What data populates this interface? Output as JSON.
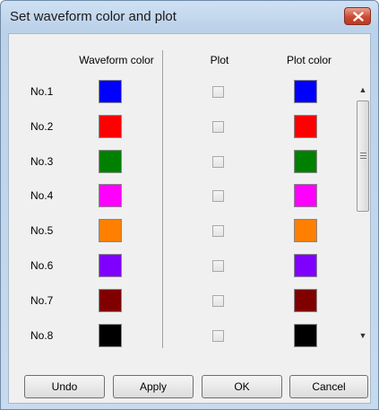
{
  "dialog": {
    "title": "Set waveform color and plot"
  },
  "headers": {
    "waveform_color": "Waveform color",
    "plot": "Plot",
    "plot_color": "Plot color"
  },
  "rows": [
    {
      "label": "No.1",
      "waveform_color": "#0000ff",
      "plot_checked": false,
      "plot_color": "#0000ff"
    },
    {
      "label": "No.2",
      "waveform_color": "#ff0000",
      "plot_checked": false,
      "plot_color": "#ff0000"
    },
    {
      "label": "No.3",
      "waveform_color": "#008000",
      "plot_checked": false,
      "plot_color": "#008000"
    },
    {
      "label": "No.4",
      "waveform_color": "#ff00ff",
      "plot_checked": false,
      "plot_color": "#ff00ff"
    },
    {
      "label": "No.5",
      "waveform_color": "#ff8000",
      "plot_checked": false,
      "plot_color": "#ff8000"
    },
    {
      "label": "No.6",
      "waveform_color": "#8000ff",
      "plot_checked": false,
      "plot_color": "#8000ff"
    },
    {
      "label": "No.7",
      "waveform_color": "#800000",
      "plot_checked": false,
      "plot_color": "#800000"
    },
    {
      "label": "No.8",
      "waveform_color": "#000000",
      "plot_checked": false,
      "plot_color": "#000000"
    }
  ],
  "buttons": {
    "undo": "Undo",
    "apply": "Apply",
    "ok": "OK",
    "cancel": "Cancel"
  },
  "icons": {
    "close": "close-icon",
    "scroll_up": "scroll-up-arrow-icon",
    "scroll_down": "scroll-down-arrow-icon"
  }
}
